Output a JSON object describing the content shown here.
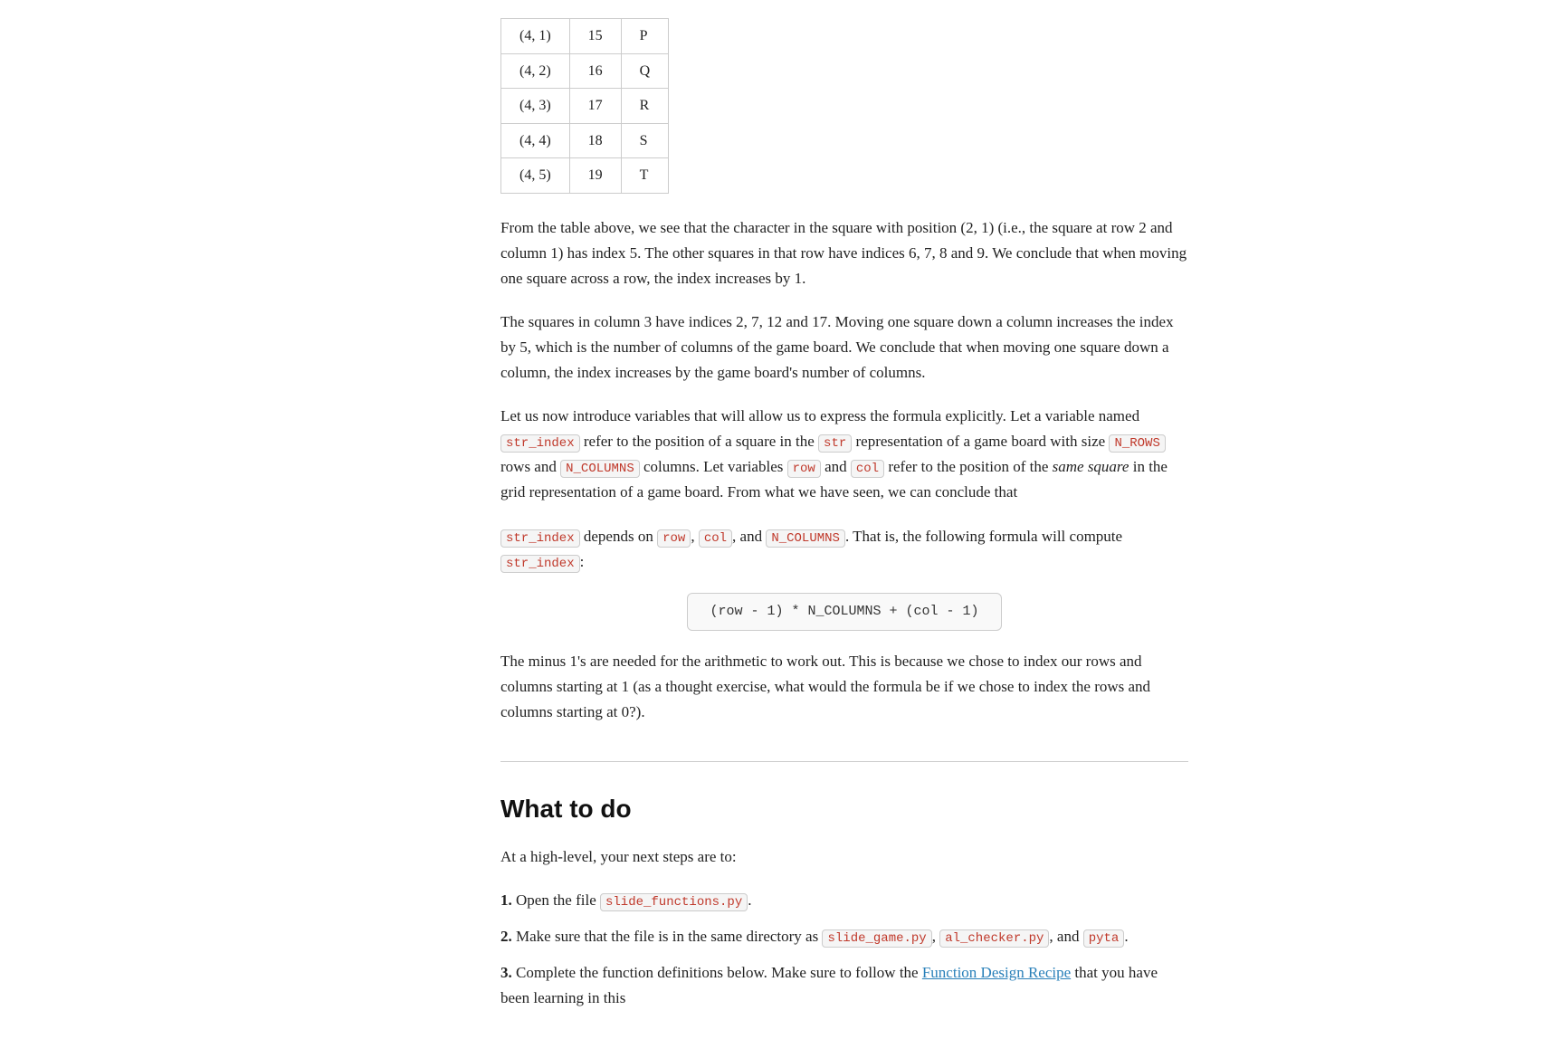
{
  "table": {
    "rows": [
      {
        "col1": "(4, 1)",
        "col2": "15",
        "col3": "P"
      },
      {
        "col1": "(4, 2)",
        "col2": "16",
        "col3": "Q"
      },
      {
        "col1": "(4, 3)",
        "col2": "17",
        "col3": "R"
      },
      {
        "col1": "(4, 4)",
        "col2": "18",
        "col3": "S"
      },
      {
        "col1": "(4, 5)",
        "col2": "19",
        "col3": "T"
      }
    ]
  },
  "paragraphs": {
    "p1": "From the table above, we see that the character in the square with position (2, 1) (i.e., the square at row 2 and column 1) has index 5. The other squares in that row have indices 6, 7, 8 and 9. We conclude that when moving one square across a row, the index increases by 1.",
    "p2": "The squares in column 3 have indices 2, 7, 12 and 17. Moving one square down a column increases the index by 5, which is the number of columns of the game board. We conclude that when moving one square down a column, the index increases by the game board's number of columns.",
    "p3_before": "Let us now introduce variables that will allow us to express the formula explicitly. Let a variable named ",
    "p3_str_index": "str_index",
    "p3_middle1": " refer to the position of a square in the ",
    "p3_str": "str",
    "p3_middle2": " representation of a game board with size ",
    "p3_n_rows": "N_ROWS",
    "p3_middle3": " rows and ",
    "p3_n_columns": "N_COLUMNS",
    "p3_middle4": " columns. Let variables ",
    "p3_row": "row",
    "p3_middle5": " and ",
    "p3_col": "col",
    "p3_middle6": " refer to the position of the ",
    "p3_italic": "same square",
    "p3_end": " in the grid representation of a game board. From what we have seen, we can conclude that",
    "p4_str_index": "str_index",
    "p4_middle1": " depends on ",
    "p4_row": "row",
    "p4_comma1": ", ",
    "p4_col": "col",
    "p4_comma2": ", and ",
    "p4_n_columns": "N_COLUMNS",
    "p4_end": ". That is, the following formula will compute ",
    "p4_str_index2": "str_index",
    "p4_colon": ":",
    "formula": "(row - 1) * N_COLUMNS + (col - 1)",
    "p5": "The minus 1's are needed for the arithmetic to work out. This is because we chose to index our rows and columns starting at 1 (as a thought exercise, what would the formula be if we chose to index the rows and columns starting at 0?).",
    "section_title": "What to do",
    "high_level": "At a high-level, your next steps are to:",
    "step1_before": "Open the file ",
    "step1_code": "slide_functions.py",
    "step1_after": ".",
    "step2_before": "Make sure that the file is in the same directory as ",
    "step2_code1": "slide_game.py",
    "step2_comma": ",",
    "step2_code2": "al_checker.py",
    "step2_middle": ", and ",
    "step2_code3": "pyta",
    "step2_after": ".",
    "step3_before": "Complete the function definitions below. Make sure to follow the ",
    "step3_link": "Function Design Recipe",
    "step3_after": " that you have been learning in this"
  }
}
